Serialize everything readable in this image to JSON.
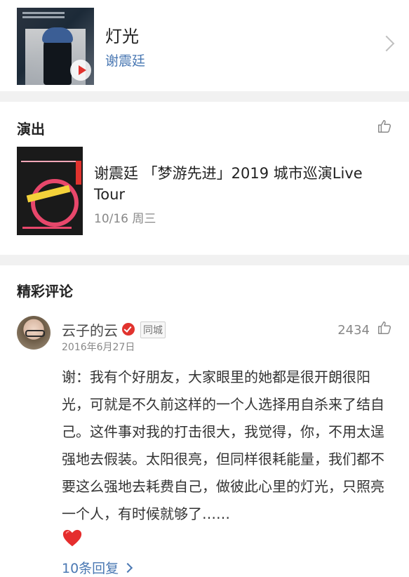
{
  "song": {
    "title": "灯光",
    "artist": "谢震廷"
  },
  "performances": {
    "section_title": "演出",
    "event": {
      "title": "谢震廷 「梦游先进」2019 城市巡演Live Tour",
      "date": "10/16 周三"
    }
  },
  "hot_comments": {
    "section_title": "精彩评论",
    "comment": {
      "user_name": "云子的云",
      "tag": "同城",
      "time": "2016年6月27日",
      "likes": "2434",
      "text": "谢：我有个好朋友，大家眼里的她都是很开朗很阳光，可就是不久前这样的一个人选择用自杀来了结自己。这件事对我的打击很大，我觉得，你，不用太逞强地去假装。太阳很亮，但同样很耗能量，我们都不要这么强地去耗费自己，做彼此心里的灯光，只照亮一个人，有时候就够了……",
      "emoji": "heart-icon",
      "replies_label": "10条回复"
    }
  },
  "colors": {
    "link_blue": "#4a78b3",
    "accent_red": "#e1332e",
    "separator": "#f1f1f1"
  }
}
